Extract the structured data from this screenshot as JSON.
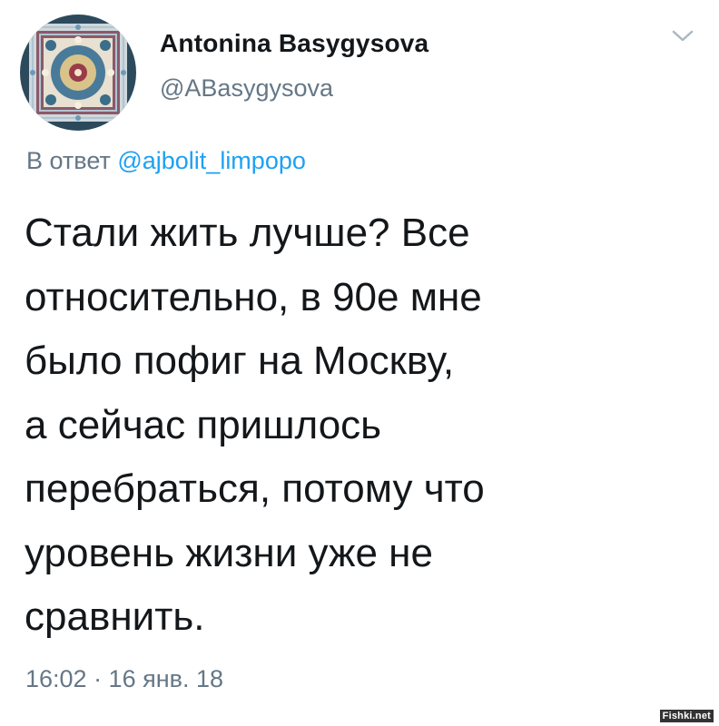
{
  "author": {
    "display_name": "Antonina Basygysova",
    "handle": "@ABasygysova"
  },
  "reply": {
    "prefix": "В ответ",
    "mention": "@ajbolit_limpopo"
  },
  "tweet": {
    "lines": [
      "Стали жить лучше? Все",
      "относительно, в 90е мне",
      "было пофиг на Москву,",
      "а сейчас пришлось",
      "перебраться, потому что",
      "уровень жизни уже не",
      "сравнить."
    ]
  },
  "timestamp": "16:02 · 16 янв. 18",
  "watermark": "Fishki.net",
  "icons": {
    "menu": "chevron-down-icon",
    "avatar": "ornament-avatar"
  },
  "colors": {
    "text": "#14171a",
    "secondary": "#657786",
    "link": "#1da1f2"
  }
}
